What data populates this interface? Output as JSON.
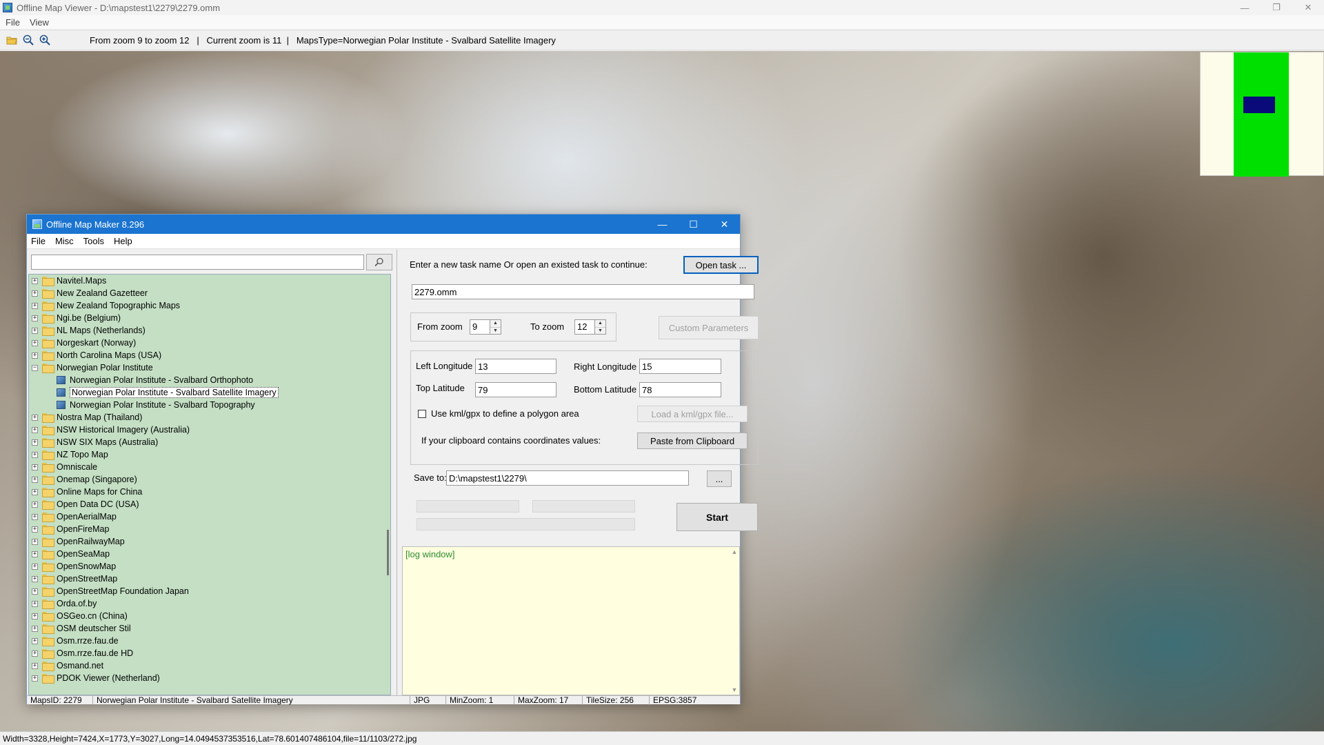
{
  "viewer": {
    "title": "Offline Map Viewer - D:\\mapstest1\\2279\\2279.omm",
    "menu": [
      "File",
      "View"
    ],
    "toolbar_text": "From zoom 9 to zoom 12   |   Current zoom is 11  |   MapsType=Norwegian Polar Institute - Svalbard Satellite Imagery",
    "status": "Width=3328,Height=7424,X=1773,Y=3027,Long=14.0494537353516,Lat=78.601407486104,file=11/1103/272.jpg"
  },
  "dialog": {
    "title": "Offline Map Maker 8.296",
    "menu": [
      "File",
      "Misc",
      "Tools",
      "Help"
    ],
    "search": {
      "value": "",
      "placeholder": ""
    },
    "tree": [
      {
        "label": "Navitel.Maps",
        "expanded": false
      },
      {
        "label": "New Zealand Gazetteer",
        "expanded": false
      },
      {
        "label": "New Zealand Topographic Maps",
        "expanded": false
      },
      {
        "label": "Ngi.be (Belgium)",
        "expanded": false
      },
      {
        "label": "NL Maps (Netherlands)",
        "expanded": false
      },
      {
        "label": "Norgeskart (Norway)",
        "expanded": false
      },
      {
        "label": "North Carolina Maps (USA)",
        "expanded": false
      },
      {
        "label": "Norwegian Polar Institute",
        "expanded": true,
        "children": [
          {
            "label": "Norwegian Polar Institute - Svalbard Orthophoto",
            "selected": false
          },
          {
            "label": "Norwegian Polar Institute - Svalbard Satellite Imagery",
            "selected": true
          },
          {
            "label": "Norwegian Polar Institute - Svalbard Topography",
            "selected": false
          }
        ]
      },
      {
        "label": "Nostra Map (Thailand)",
        "expanded": false
      },
      {
        "label": "NSW Historical Imagery (Australia)",
        "expanded": false
      },
      {
        "label": "NSW SIX Maps (Australia)",
        "expanded": false
      },
      {
        "label": "NZ Topo Map",
        "expanded": false
      },
      {
        "label": "Omniscale",
        "expanded": false
      },
      {
        "label": "Onemap (Singapore)",
        "expanded": false
      },
      {
        "label": "Online Maps for China",
        "expanded": false
      },
      {
        "label": "Open Data DC (USA)",
        "expanded": false
      },
      {
        "label": "OpenAerialMap",
        "expanded": false
      },
      {
        "label": "OpenFireMap",
        "expanded": false
      },
      {
        "label": "OpenRailwayMap",
        "expanded": false
      },
      {
        "label": "OpenSeaMap",
        "expanded": false
      },
      {
        "label": "OpenSnowMap",
        "expanded": false
      },
      {
        "label": "OpenStreetMap",
        "expanded": false
      },
      {
        "label": "OpenStreetMap Foundation Japan",
        "expanded": false
      },
      {
        "label": "Orda.of.by",
        "expanded": false
      },
      {
        "label": "OSGeo.cn (China)",
        "expanded": false
      },
      {
        "label": "OSM deutscher Stil",
        "expanded": false
      },
      {
        "label": "Osm.rrze.fau.de",
        "expanded": false
      },
      {
        "label": "Osm.rrze.fau.de HD",
        "expanded": false
      },
      {
        "label": "Osmand.net",
        "expanded": false
      },
      {
        "label": "PDOK Viewer (Netherland)",
        "expanded": false
      }
    ],
    "task": {
      "prompt": "Enter a new task name Or open an existed task to continue:",
      "open_button": "Open task ...",
      "name": "2279.omm"
    },
    "zoom": {
      "from_label": "From zoom",
      "from_value": "9",
      "to_label": "To zoom",
      "to_value": "12",
      "custom_button": "Custom Parameters"
    },
    "coords": {
      "left_lon_label": "Left Longitude",
      "left_lon": "13",
      "right_lon_label": "Right Longitude",
      "right_lon": "15",
      "top_lat_label": "Top Latitude",
      "top_lat": "79",
      "bottom_lat_label": "Bottom Latitude",
      "bottom_lat": "78",
      "kml_label": "Use kml/gpx to define a polygon area",
      "kml_button": "Load a kml/gpx file...",
      "clipboard_label": "If your clipboard contains coordinates values:",
      "clipboard_button": "Paste from Clipboard"
    },
    "save": {
      "label": "Save to:",
      "path": "D:\\mapstest1\\2279\\",
      "browse_button": "...",
      "start_button": "Start"
    },
    "log": "[log window]",
    "status": {
      "maps_id": "MapsID: 2279",
      "name": "Norwegian Polar Institute - Svalbard Satellite Imagery",
      "format": "JPG",
      "min_zoom": "MinZoom: 1",
      "max_zoom": "MaxZoom: 17",
      "tile_size": "TileSize: 256",
      "epsg": "EPSG:3857"
    }
  },
  "colors": {
    "dialog_title": "#1a74d0",
    "tree_bg": "#c4dfc4",
    "log_bg": "#ffffe0",
    "overview_green": "#00e000",
    "overview_viewport": "#0a0a7a"
  }
}
